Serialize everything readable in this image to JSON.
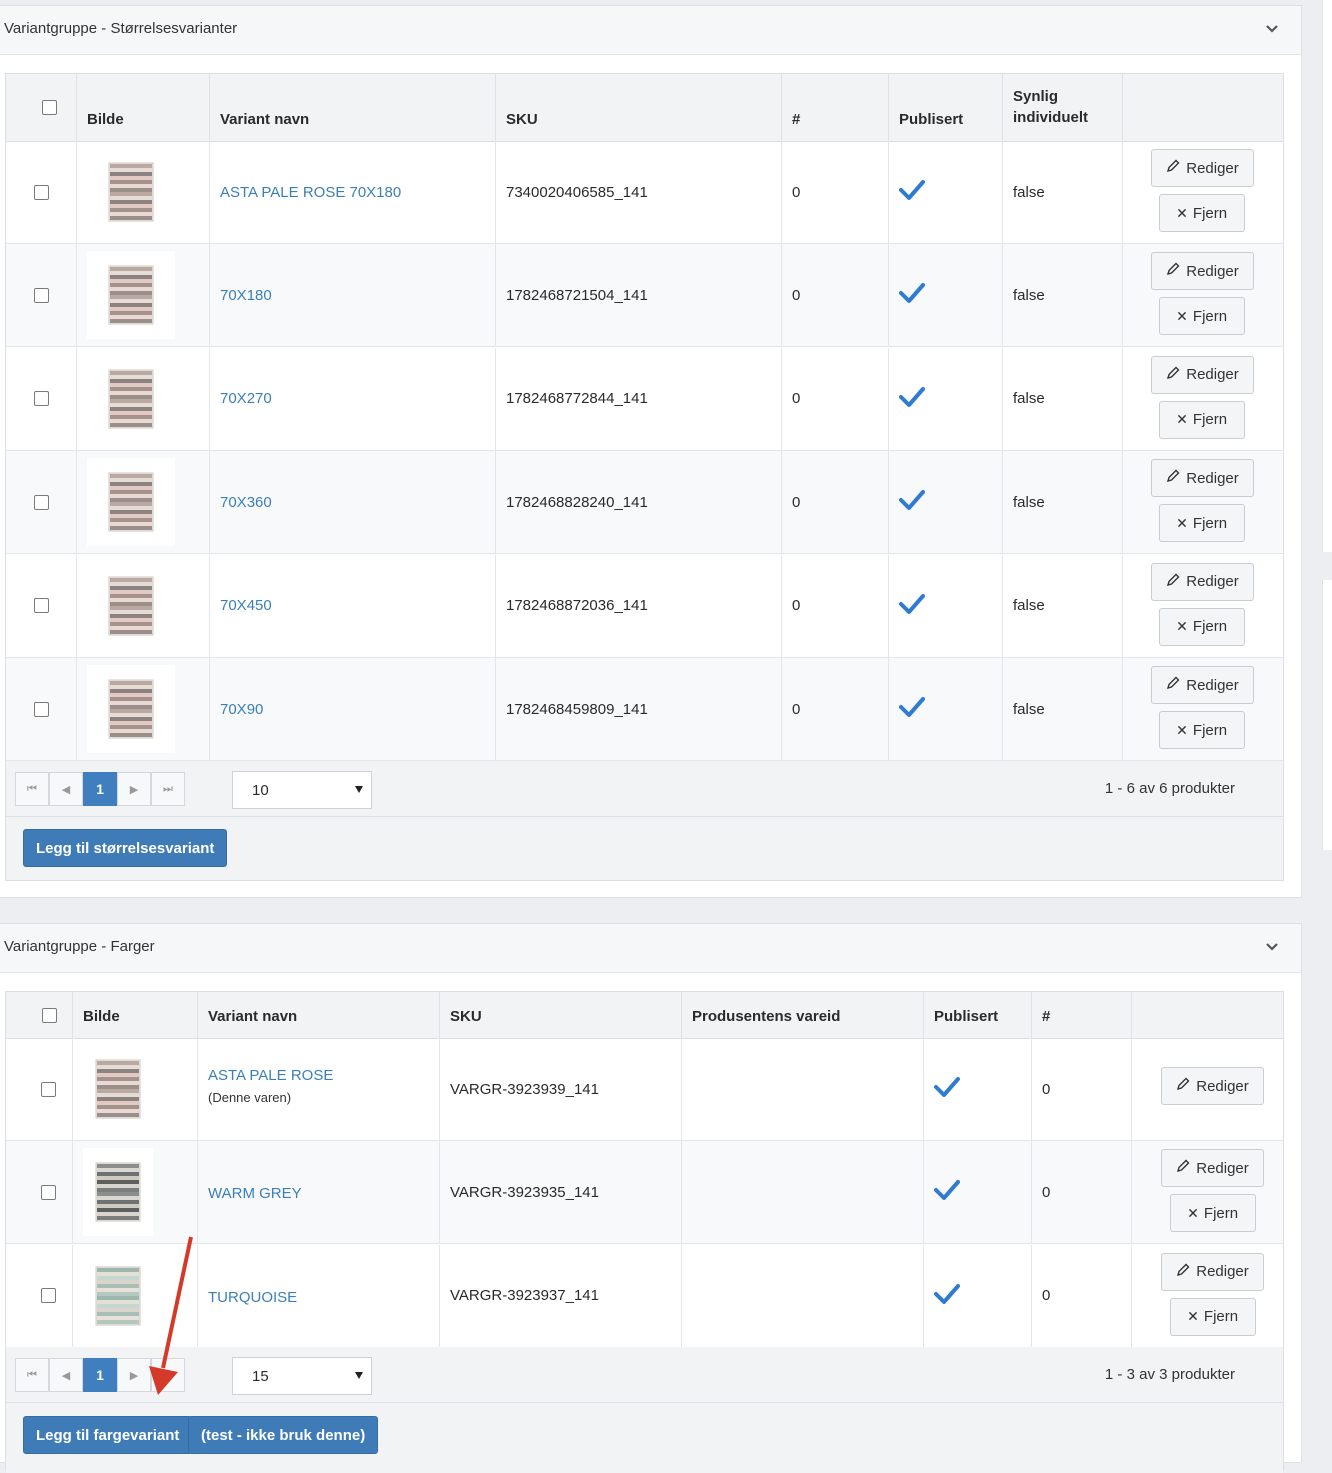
{
  "colors": {
    "accent": "#3f7cb7",
    "link": "#3b7fb8",
    "check": "#2f7bd0",
    "annotation_arrow": "#d43a2a"
  },
  "icons": {
    "collapse": "chevron-down-icon",
    "edit": "pencil-icon",
    "remove": "x-icon",
    "published": "checkmark-icon",
    "first": "first-page-icon",
    "prev": "prev-page-icon",
    "next": "next-page-icon",
    "last": "last-page-icon"
  },
  "size_group": {
    "title": "Variantgruppe - Størrelsesvarianter",
    "headers": {
      "image": "Bilde",
      "name": "Variant navn",
      "sku": "SKU",
      "count": "#",
      "published": "Publisert",
      "visible": "Synlig individuelt"
    },
    "rows": [
      {
        "name": "ASTA PALE ROSE 70X180",
        "sku": "7340020406585_141",
        "count": "0",
        "published": true,
        "visible": "false"
      },
      {
        "name": "70X180",
        "sku": "1782468721504_141",
        "count": "0",
        "published": true,
        "visible": "false"
      },
      {
        "name": "70X270",
        "sku": "1782468772844_141",
        "count": "0",
        "published": true,
        "visible": "false"
      },
      {
        "name": "70X360",
        "sku": "1782468828240_141",
        "count": "0",
        "published": true,
        "visible": "false"
      },
      {
        "name": "70X450",
        "sku": "1782468872036_141",
        "count": "0",
        "published": true,
        "visible": "false"
      },
      {
        "name": "70X90",
        "sku": "1782468459809_141",
        "count": "0",
        "published": true,
        "visible": "false"
      }
    ],
    "edit_label": "Rediger",
    "remove_label": "Fjern",
    "pager": {
      "current_page": "1",
      "page_size": "10",
      "info": "1 - 6 av 6 produkter"
    },
    "add_button": "Legg til størrelsesvariant"
  },
  "color_group": {
    "title": "Variantgruppe - Farger",
    "headers": {
      "image": "Bilde",
      "name": "Variant navn",
      "sku": "SKU",
      "manufacturer_id": "Produsentens vareid",
      "published": "Publisert",
      "count": "#"
    },
    "rows": [
      {
        "name": "ASTA PALE ROSE",
        "note": "(Denne varen)",
        "sku": "VARGR-3923939_141",
        "manufacturer_id": "",
        "published": true,
        "count": "0"
      },
      {
        "name": "WARM GREY",
        "note": "",
        "sku": "VARGR-3923935_141",
        "manufacturer_id": "",
        "published": true,
        "count": "0"
      },
      {
        "name": "TURQUOISE",
        "note": "",
        "sku": "VARGR-3923937_141",
        "manufacturer_id": "",
        "published": true,
        "count": "0"
      }
    ],
    "edit_label": "Rediger",
    "remove_label": "Fjern",
    "pager": {
      "current_page": "1",
      "page_size": "15",
      "info": "1 - 3 av 3 produkter"
    },
    "add_button": "Legg til fargevariant",
    "test_button": "(test - ikke bruk denne)"
  }
}
